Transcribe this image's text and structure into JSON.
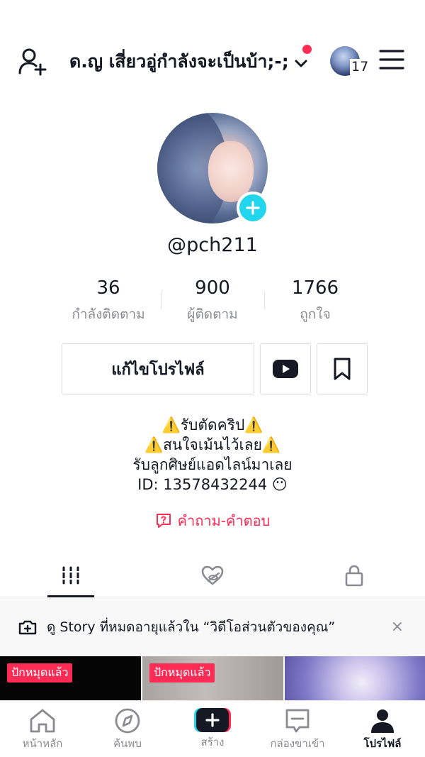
{
  "header": {
    "add_user_icon": "person-add-icon",
    "title": "ด.ญ เสี่ยวอู่กำลังจะเป็นบ้า;-;",
    "notification_count": "17",
    "menu_icon": "hamburger-menu-icon",
    "dot_color": "#fe2c55"
  },
  "profile": {
    "username": "@pch211",
    "stats": [
      {
        "value": "36",
        "label": "กำลังติดตาม"
      },
      {
        "value": "900",
        "label": "ผู้ติดตาม"
      },
      {
        "value": "1766",
        "label": "ถูกใจ"
      }
    ],
    "edit_button": "แก้ไขโปรไฟล์",
    "bio": [
      "⚠️รับตัดคริป⚠️",
      "⚠️สนใจเม้นไว้เลย⚠️",
      "รับลูกศิษย์แอดไลน์มาเลย",
      "ID: 13578432244 😶"
    ],
    "qa_link": "คำถาม-คำตอบ",
    "accent_color": "#fe2c55",
    "badge_color": "#20d5ec"
  },
  "tabs": [
    {
      "icon": "grid-icon",
      "active": true
    },
    {
      "icon": "liked-hidden-icon",
      "active": false
    },
    {
      "icon": "lock-icon",
      "active": false
    }
  ],
  "story_banner": {
    "text": "ดู Story ที่หมดอายุแล้วใน “วิดีโอส่วนตัวของคุณ”",
    "close": "×"
  },
  "videos": [
    {
      "pinned_label": "ปักหมุดแล้ว"
    },
    {
      "pinned_label": "ปักหมุดแล้ว"
    },
    {
      "pinned_label": ""
    }
  ],
  "bottom_nav": [
    {
      "label": "หน้าหลัก",
      "icon": "home-icon"
    },
    {
      "label": "ค้นพบ",
      "icon": "compass-icon"
    },
    {
      "label": "สร้าง",
      "icon": "create-plus-icon"
    },
    {
      "label": "กล่องขาเข้า",
      "icon": "inbox-icon"
    },
    {
      "label": "โปรไฟล์",
      "icon": "profile-icon",
      "active": true
    }
  ]
}
